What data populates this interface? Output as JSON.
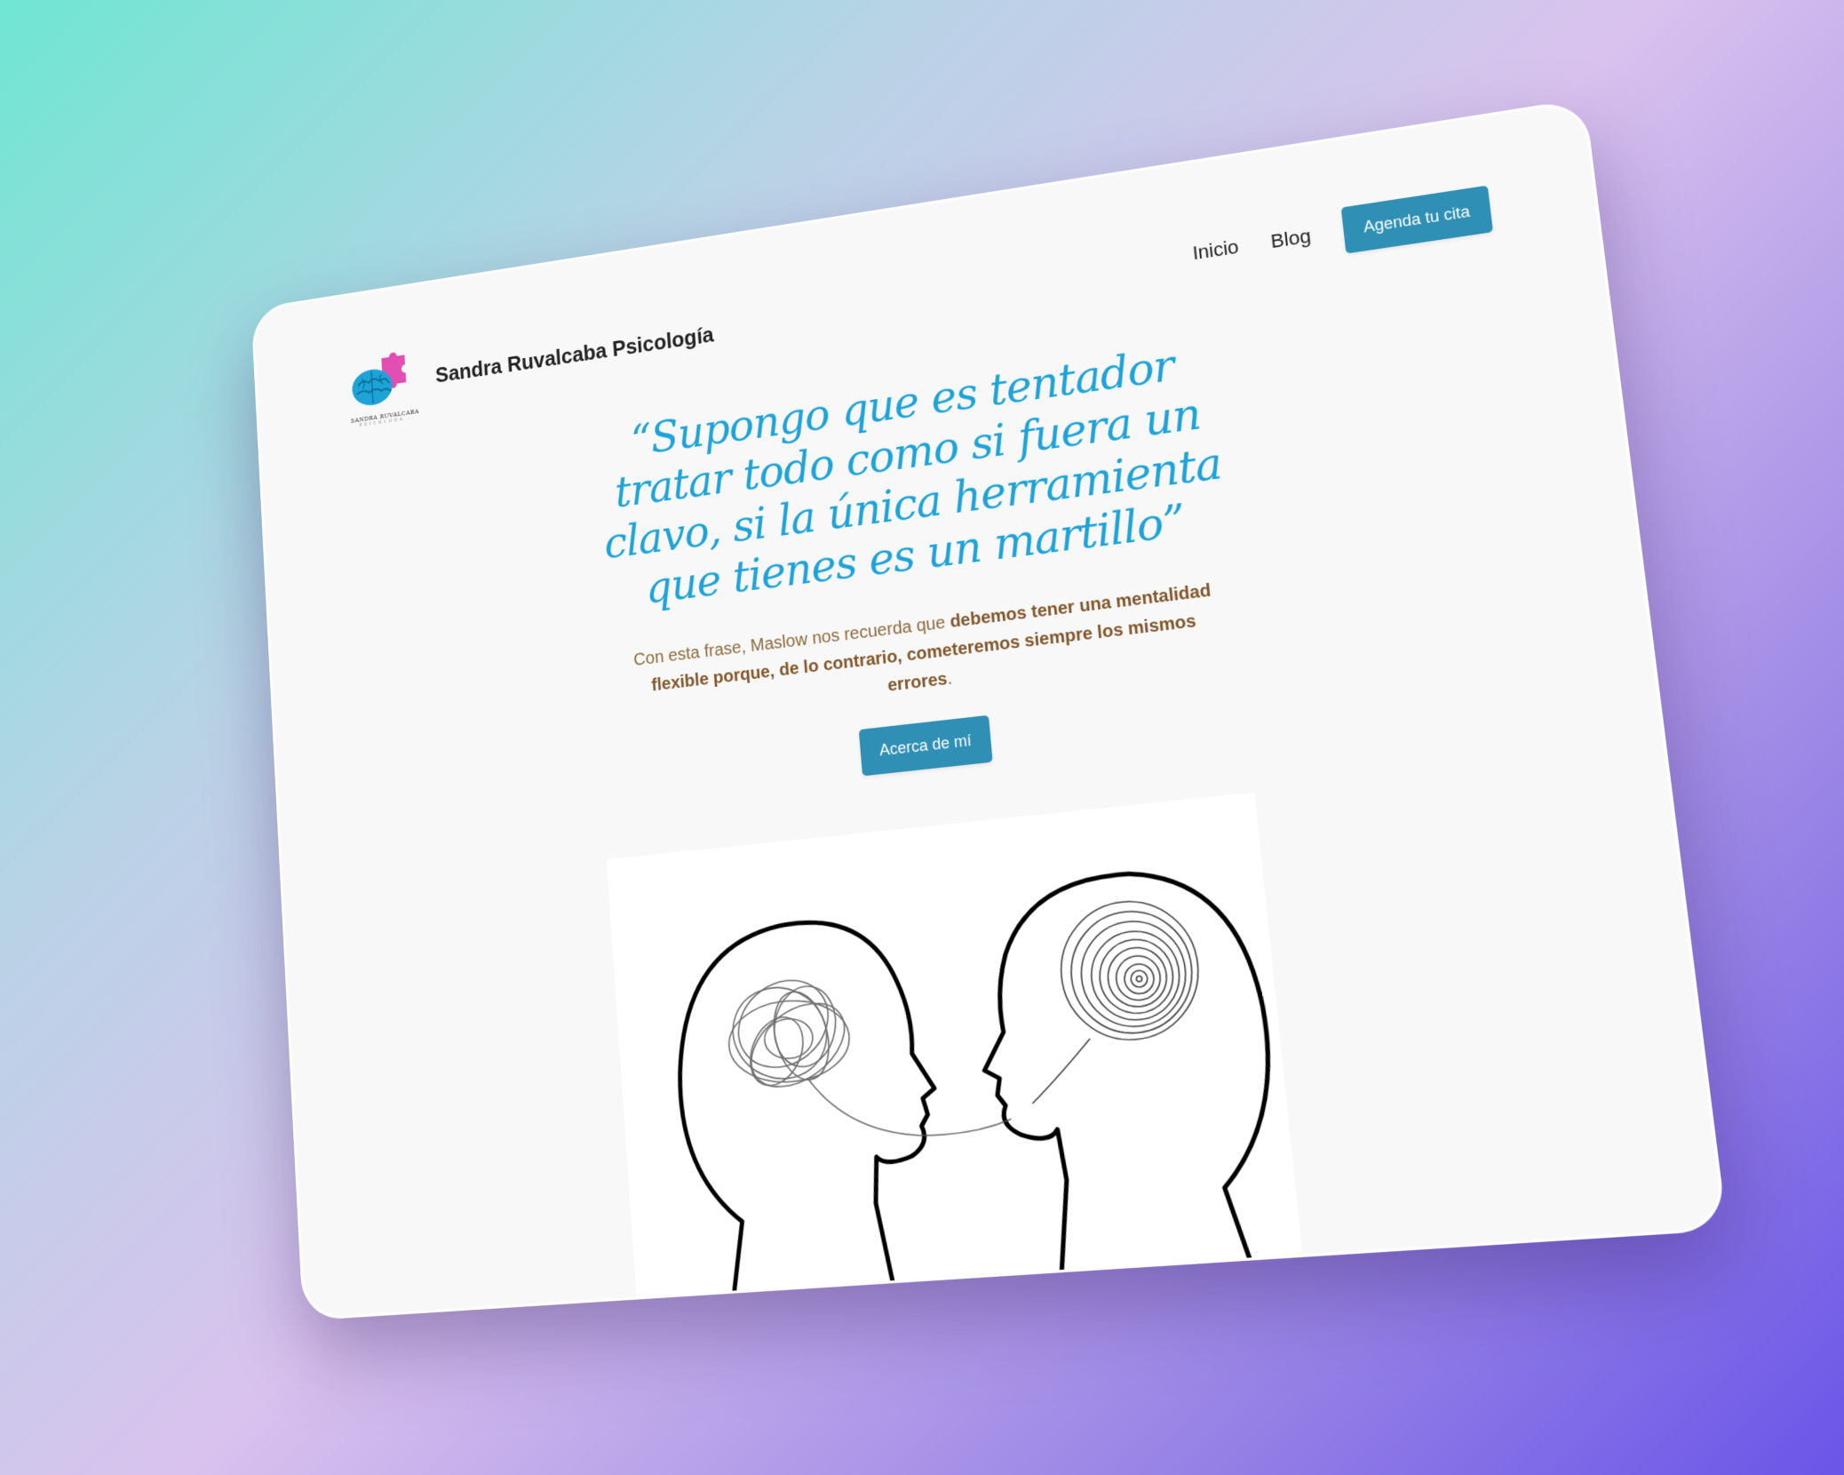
{
  "header": {
    "site_name": "Sandra Ruvalcaba Psicología",
    "logo": {
      "caption": "SANDRA RUVALCABA",
      "caption_sub": "PSICÓLOGA",
      "icon": "brain-puzzle-logo",
      "colors": {
        "brain": "#1ea3d8",
        "puzzle": "#e24fb3"
      }
    },
    "nav": {
      "items": [
        {
          "label": "Inicio"
        },
        {
          "label": "Blog"
        }
      ],
      "cta_label": "Agenda tu cita"
    }
  },
  "hero": {
    "quote": "“Supongo que es tentador tratar todo como si fuera un clavo, si la única herramienta que tienes es un martillo”",
    "subtext_plain_1": "Con esta frase, Maslow nos recuerda que ",
    "subtext_bold": "debemos tener una mentalidad flexible porque, de lo contrario, cometeremos siempre los mismos errores",
    "subtext_plain_2": ".",
    "button_label": "Acerca de mí"
  },
  "illustration": {
    "icon": "two-heads-tangled-and-spiral-thoughts"
  },
  "colors": {
    "accent": "#2f8fb4",
    "quote": "#1ea3d8",
    "subtext": "#8a6a3c",
    "page_bg": "#f8f8f8"
  }
}
